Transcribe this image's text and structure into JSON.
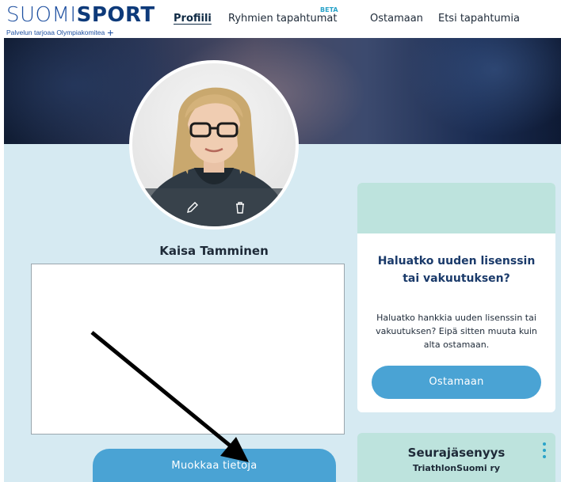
{
  "header": {
    "logo": {
      "thin": "SUOMI",
      "bold": "SPORT",
      "tagline": "Palvelun tarjoaa Olympiakomitea",
      "plus": "+"
    },
    "nav": [
      {
        "label": "Profiili",
        "active": true
      },
      {
        "label": "Ryhmien tapahtumat",
        "badge": "BETA"
      },
      {
        "label": "Ostamaan"
      },
      {
        "label": "Etsi tapahtumia"
      }
    ]
  },
  "profile": {
    "name": "Kaisa Tamminen",
    "edit_icon": "pencil-icon",
    "delete_icon": "trash-icon",
    "edit_button": "Muokkaa tietoja"
  },
  "license_card": {
    "title": "Haluatko uuden lisenssin tai vakuutuksen?",
    "text": "Haluatko hankkia uuden lisenssin tai vakuutuksen? Eipä sitten muuta kuin alta ostamaan.",
    "button": "Ostamaan"
  },
  "membership_card": {
    "title": "Seurajäsenyys",
    "club": "TriathlonSuomi ry",
    "menu_icon": "kebab-menu-icon"
  },
  "colors": {
    "accent": "#4aa3d4",
    "background": "#d6eaf2",
    "card_header": "#bde3dd",
    "title_blue": "#1a3a6a"
  }
}
